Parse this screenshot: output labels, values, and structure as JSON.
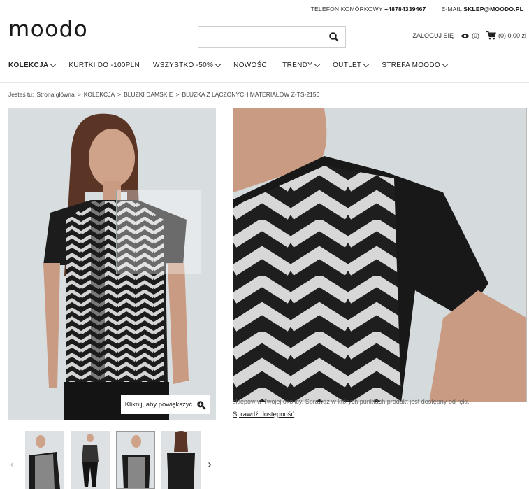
{
  "topbar": {
    "phone_label": "TELEFON KOMÓRKOWY",
    "phone_value": "+48784339467",
    "email_label": "E-MAIL",
    "email_value": "SKLEP@MOODO.PL"
  },
  "logo": "moodo",
  "search": {
    "value": "",
    "placeholder": ""
  },
  "user": {
    "login": "ZALOGUJ SIĘ",
    "watch_count": "(0)",
    "cart_text": "(0) 0,00 zł"
  },
  "nav": [
    {
      "label": "KOLEKCJA",
      "dropdown": true,
      "bold": true
    },
    {
      "label": "KURTKI DO -100PLN",
      "dropdown": false
    },
    {
      "label": "WSZYSTKO -50%",
      "dropdown": true
    },
    {
      "label": "NOWOŚCI",
      "dropdown": false
    },
    {
      "label": "TRENDY",
      "dropdown": true
    },
    {
      "label": "OUTLET",
      "dropdown": true
    },
    {
      "label": "STREFA MOODO",
      "dropdown": true
    }
  ],
  "breadcrumb": {
    "prefix": "Jesteś tu:",
    "items": [
      "Strona główna",
      "KOLEKCJA",
      "BLUZKI DAMSKIE",
      "BLUZKA Z ŁĄCZONYCH MATERIAŁÓW Z-TS-2150"
    ],
    "separator": ">"
  },
  "gallery": {
    "enlarge_label": "Kliknij, aby powiększyć",
    "thumb_count": 4
  },
  "availability": {
    "note": "sklepów w Twojej okolicy. Sprawdź w których punktach produkt jest dostępny od ręki.",
    "link": "Sprawdź dostępność"
  },
  "colors": {
    "shirt_black": "#1c1c1c",
    "silver": "#d4d4d4",
    "skin": "#c99b83",
    "hair": "#5a3424",
    "bg": "#d8dde0"
  }
}
